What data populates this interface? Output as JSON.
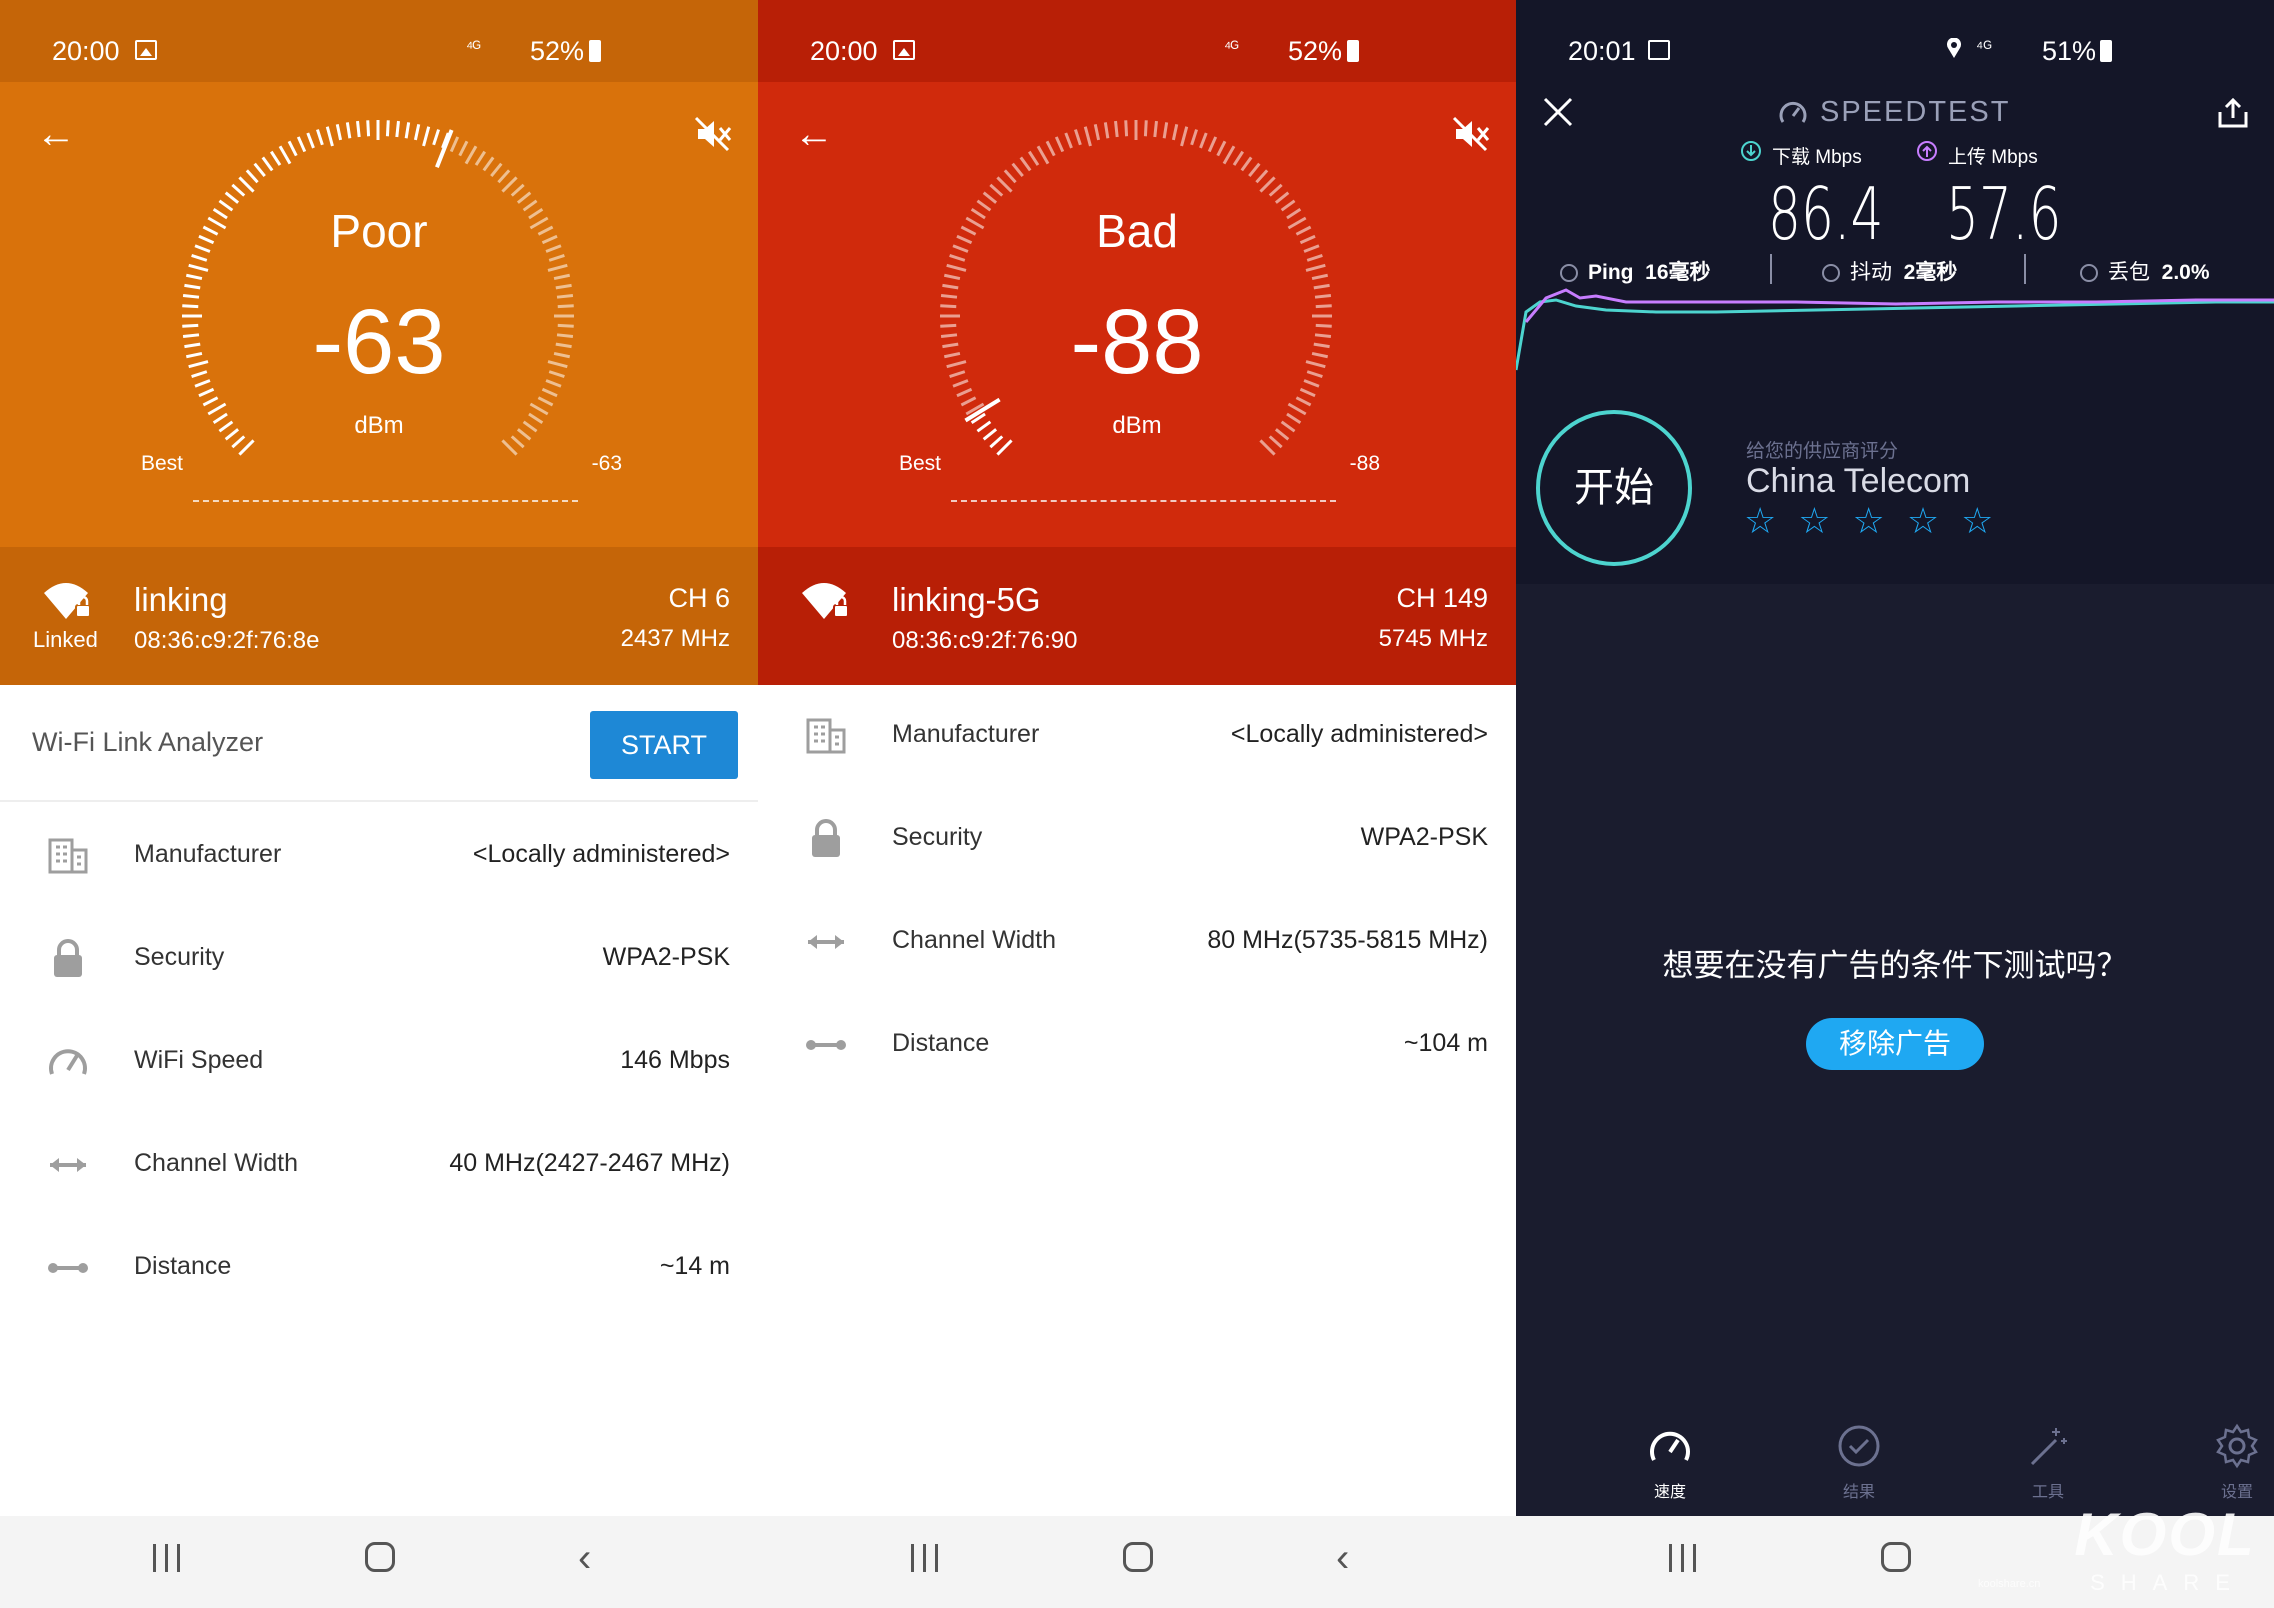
{
  "colors": {
    "poor": "#d9720b",
    "poor_dark": "#c56508",
    "bad": "#d02a0c",
    "bad_dark": "#b81f06",
    "speedtest_bg": "#1a1c2e",
    "accent_blue": "#1fa8f2",
    "accent_teal": "#4dd4cf"
  },
  "panel1": {
    "status": {
      "time": "20:00",
      "signal": "⁴ᴳ",
      "battery": "52%"
    },
    "gauge": {
      "quality": "Poor",
      "value": "-63",
      "unit": "dBm",
      "best_label": "Best",
      "scale_value": "-63",
      "level_fraction": 0.58
    },
    "network": {
      "ssid": "linking",
      "bssid": "08:36:c9:2f:76:8e",
      "linked_label": "Linked",
      "channel": "CH 6",
      "frequency": "2437 MHz"
    },
    "analyzer": {
      "title": "Wi-Fi Link Analyzer",
      "start_label": "START"
    },
    "rows": [
      {
        "icon": "building-icon",
        "label": "Manufacturer",
        "value": "<Locally administered>"
      },
      {
        "icon": "lock-icon",
        "label": "Security",
        "value": "WPA2-PSK"
      },
      {
        "icon": "speedometer-icon",
        "label": "WiFi Speed",
        "value": "146 Mbps"
      },
      {
        "icon": "width-arrows-icon",
        "label": "Channel Width",
        "value": "40 MHz(2427-2467 MHz)"
      },
      {
        "icon": "distance-icon",
        "label": "Distance",
        "value": "~14 m"
      }
    ]
  },
  "panel2": {
    "status": {
      "time": "20:00",
      "signal": "⁴ᴳ",
      "battery": "52%"
    },
    "gauge": {
      "quality": "Bad",
      "value": "-88",
      "unit": "dBm",
      "best_label": "Best",
      "scale_value": "-88",
      "level_fraction": 0.05
    },
    "network": {
      "ssid": "linking-5G",
      "bssid": "08:36:c9:2f:76:90",
      "channel": "CH 149",
      "frequency": "5745 MHz"
    },
    "rows": [
      {
        "icon": "building-icon",
        "label": "Manufacturer",
        "value": "<Locally administered>"
      },
      {
        "icon": "lock-icon",
        "label": "Security",
        "value": "WPA2-PSK"
      },
      {
        "icon": "width-arrows-icon",
        "label": "Channel Width",
        "value": "80 MHz(5735-5815 MHz)"
      },
      {
        "icon": "distance-icon",
        "label": "Distance",
        "value": "~104 m"
      }
    ]
  },
  "panel3": {
    "status": {
      "time": "20:01",
      "signal": "⁴ᴳ",
      "battery": "51%"
    },
    "app_title": "SPEEDTEST",
    "download": {
      "label": "下载 Mbps",
      "value": "86.4"
    },
    "upload": {
      "label": "上传 Mbps",
      "value": "57.6"
    },
    "ping": {
      "label": "Ping",
      "value": "16毫秒"
    },
    "jitter": {
      "label": "抖动",
      "value": "2毫秒"
    },
    "loss": {
      "label": "丢包",
      "value": "2.0%"
    },
    "start_label": "开始",
    "provider_caption": "给您的供应商评分",
    "provider_name": "China Telecom",
    "stars": "☆ ☆ ☆ ☆ ☆",
    "ad_question": "想要在没有广告的条件下测试吗？",
    "remove_ads_label": "移除广告",
    "tabs": [
      {
        "icon": "speed-gauge-icon",
        "label": "速度"
      },
      {
        "icon": "check-circle-icon",
        "label": "结果"
      },
      {
        "icon": "magic-wand-icon",
        "label": "工具"
      },
      {
        "icon": "gear-icon",
        "label": "设置"
      }
    ]
  },
  "watermark": {
    "brand": "KOOL",
    "sub": "SHARE",
    "site": "koolshare.cn"
  }
}
